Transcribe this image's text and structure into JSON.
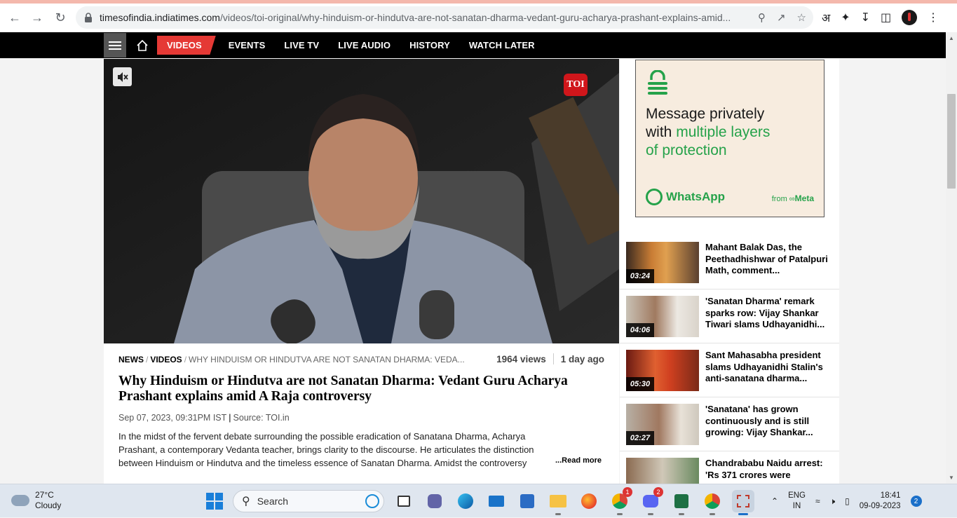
{
  "browser": {
    "url_host": "timesofindia.indiatimes.com",
    "url_path": "/videos/toi-original/why-hinduism-or-hindutva-are-not-sanatan-dharma-vedant-guru-acharya-prashant-explains-amid...",
    "translate_label": "अ"
  },
  "nav": {
    "items": [
      {
        "label": "VIDEOS",
        "active": true
      },
      {
        "label": "EVENTS"
      },
      {
        "label": "LIVE TV"
      },
      {
        "label": "LIVE AUDIO"
      },
      {
        "label": "HISTORY"
      },
      {
        "label": "WATCH LATER"
      }
    ]
  },
  "video": {
    "logo_text": "TOI",
    "breadcrumb": {
      "news": "NEWS",
      "videos": "VIDEOS",
      "current": "WHY HINDUISM OR HINDUTVA ARE NOT SANATAN DHARMA: VEDA..."
    },
    "views": "1964 views",
    "age": "1 day ago",
    "title": "Why Hinduism or Hindutva are not Sanatan Dharma: Vedant Guru Acharya Prashant explains amid A Raja controversy",
    "date": "Sep 07, 2023, 09:31PM IST",
    "source": "Source: TOI.in",
    "desc_line1": "In the midst of the fervent debate surrounding the possible eradication of Sanatana Dharma, Acharya",
    "desc_line2": "Prashant, a contemporary Vedanta teacher, brings clarity to the discourse. He articulates the distinction",
    "desc_line3": "between Hinduism or Hindutva and the timeless essence of Sanatan Dharma. Amidst the controversy",
    "read_more": "...Read more"
  },
  "ad": {
    "line1": "Message privately",
    "line2": "with",
    "line2_green": "multiple layers",
    "line3_green": "of protection",
    "brand": "WhatsApp",
    "from": "from",
    "meta": "Meta",
    "accent": "#25a24a"
  },
  "related": [
    {
      "duration": "03:24",
      "title": "Mahant Balak Das, the Peethadhishwar of Patalpuri Math, comment..."
    },
    {
      "duration": "04:06",
      "title": "'Sanatan Dharma' remark sparks row: Vijay Shankar Tiwari slams Udhayanidhi..."
    },
    {
      "duration": "05:30",
      "title": "Sant Mahasabha president slams Udhayanidhi Stalin's anti-sanatana dharma..."
    },
    {
      "duration": "02:27",
      "title": "'Sanatana' has grown continuously and is still growing: Vijay Shankar..."
    },
    {
      "duration": "",
      "title": "Chandrababu Naidu arrest: 'Rs 371 crores were"
    }
  ],
  "taskbar": {
    "temp": "27°C",
    "condition": "Cloudy",
    "search_placeholder": "Search",
    "chrome_badge": "1",
    "discord_badge": "2",
    "lang1": "ENG",
    "lang2": "IN",
    "time": "18:41",
    "date": "09-09-2023",
    "notifications": "2"
  }
}
